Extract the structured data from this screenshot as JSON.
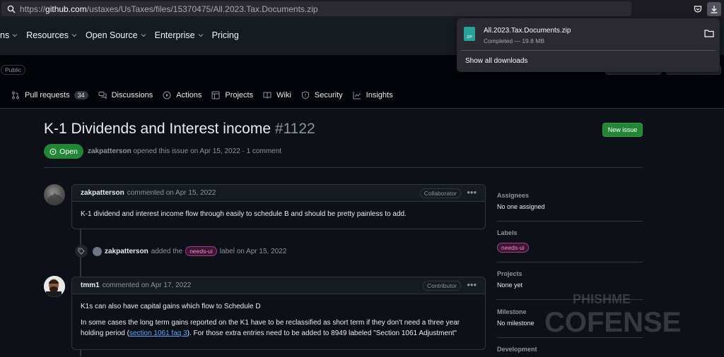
{
  "browser": {
    "url_scheme": "https://",
    "url_host": "github.com",
    "url_path": "/ustaxes/UsTaxes/files/15370475/All.2023.Tax.Documents.zip"
  },
  "download_panel": {
    "file_name": "All.2023.Tax.Documents.zip",
    "file_icon_text": "ZIP",
    "status": "Completed — 19.8 MB",
    "show_all": "Show all downloads"
  },
  "gh_nav": {
    "items": [
      "ns",
      "Resources",
      "Open Source",
      "Enterprise",
      "Pricing"
    ]
  },
  "repo": {
    "visibility": "Public",
    "tabs": [
      {
        "label": "Pull requests",
        "count": "34"
      },
      {
        "label": "Discussions"
      },
      {
        "label": "Actions"
      },
      {
        "label": "Projects"
      },
      {
        "label": "Wiki"
      },
      {
        "label": "Security"
      },
      {
        "label": "Insights"
      }
    ]
  },
  "issue": {
    "title": "K-1 Dividends and Interest income",
    "number": "#1122",
    "new_issue_label": "New issue",
    "state": "Open",
    "author": "zakpatterson",
    "meta": "opened this issue on Apr 15, 2022 · 1 comment"
  },
  "comments": [
    {
      "author": "zakpatterson",
      "meta": "commented on Apr 15, 2022",
      "role": "Collaborator",
      "body": [
        "K-1 dividend and interest income flow through easily to schedule B and should be pretty painless to add."
      ]
    },
    {
      "author": "tmm1",
      "meta": "commented on Apr 17, 2022",
      "role": "Contributor",
      "body_p1": "K1s can also have capital gains which flow to Schedule D",
      "body_p2_a": "In some cases the long term gains reported on the K1 have to be reclassified as short term if they don't need a three year holding period (",
      "body_p2_link": "section 1061 faq 3",
      "body_p2_b": "). For those extra entries need to be added to 8949 labeled \"Section 1061 Adjustment\""
    }
  ],
  "event": {
    "actor": "zakpatterson",
    "text_before": "added the",
    "label": "needs-ui",
    "text_after": "label on Apr 15, 2022"
  },
  "sidebar": {
    "assignees_label": "Assignees",
    "assignees_value": "No one assigned",
    "labels_label": "Labels",
    "labels_value": "needs-ui",
    "projects_label": "Projects",
    "projects_value": "None yet",
    "milestone_label": "Milestone",
    "milestone_value": "No milestone",
    "development_label": "Development"
  },
  "watermark": {
    "line1": "PHISHME",
    "line2": "COFENSE"
  },
  "colors": {
    "open_green": "#238636",
    "label_pink": "#ff87c4",
    "link_blue": "#58a6ff"
  }
}
